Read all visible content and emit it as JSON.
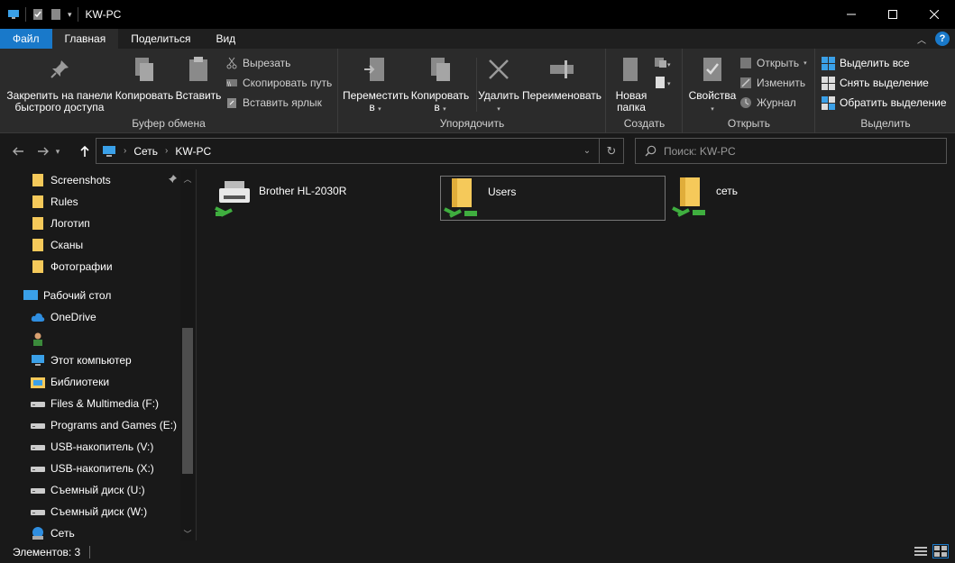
{
  "window": {
    "title": "KW-PC"
  },
  "tabs": [
    {
      "label": "Файл"
    },
    {
      "label": "Главная"
    },
    {
      "label": "Поделиться"
    },
    {
      "label": "Вид"
    }
  ],
  "ribbon": {
    "clipboard": {
      "label": "Буфер обмена",
      "pin_line1": "Закрепить на панели",
      "pin_line2": "быстрого доступа",
      "copy": "Копировать",
      "paste": "Вставить",
      "cut": "Вырезать",
      "copy_path": "Скопировать путь",
      "paste_shortcut": "Вставить ярлык"
    },
    "organize": {
      "label": "Упорядочить",
      "move_line1": "Переместить",
      "move_line2": "в",
      "copy_line1": "Копировать",
      "copy_line2": "в",
      "delete": "Удалить",
      "rename": "Переименовать"
    },
    "create": {
      "label": "Создать",
      "new_folder_line1": "Новая",
      "new_folder_line2": "папка"
    },
    "open": {
      "label": "Открыть",
      "properties": "Свойства",
      "open": "Открыть",
      "edit": "Изменить",
      "history": "Журнал"
    },
    "select": {
      "label": "Выделить",
      "select_all": "Выделить все",
      "select_none": "Снять выделение",
      "invert": "Обратить выделение"
    }
  },
  "address": {
    "crumbs": [
      "Сеть",
      "KW-PC"
    ],
    "search_placeholder": "Поиск: KW-PC"
  },
  "sidebar": {
    "items": [
      {
        "label": "Screenshots",
        "icon": "folder-icon"
      },
      {
        "label": "Rules",
        "icon": "folder-icon"
      },
      {
        "label": "Логотип",
        "icon": "folder-icon"
      },
      {
        "label": "Сканы",
        "icon": "folder-icon"
      },
      {
        "label": "Фотографии",
        "icon": "folder-icon"
      },
      {
        "label": "Рабочий стол",
        "icon": "desktop-icon"
      },
      {
        "label": "OneDrive",
        "icon": "cloud-icon"
      },
      {
        "label": "",
        "icon": "user-icon"
      },
      {
        "label": "Этот компьютер",
        "icon": "computer-icon"
      },
      {
        "label": "Библиотеки",
        "icon": "library-icon"
      },
      {
        "label": "Files & Multimedia (F:)",
        "icon": "drive-icon"
      },
      {
        "label": "Programs and Games (E:)",
        "icon": "drive-icon"
      },
      {
        "label": "USB-накопитель (V:)",
        "icon": "drive-icon"
      },
      {
        "label": "USB-накопитель (X:)",
        "icon": "drive-icon"
      },
      {
        "label": "Съемный диск (U:)",
        "icon": "drive-icon"
      },
      {
        "label": "Съемный диск (W:)",
        "icon": "drive-icon"
      },
      {
        "label": "Сеть",
        "icon": "network-icon"
      }
    ]
  },
  "content": {
    "items": [
      {
        "name": "Brother HL-2030R",
        "icon": "network-printer-icon"
      },
      {
        "name": "Users",
        "icon": "shared-folder-icon"
      },
      {
        "name": "сеть",
        "icon": "shared-folder-icon"
      }
    ]
  },
  "status": {
    "text": "Элементов: 3"
  },
  "colors": {
    "accent": "#1979ca",
    "folder": "#f5c95a",
    "network_green": "#3fae3f"
  }
}
